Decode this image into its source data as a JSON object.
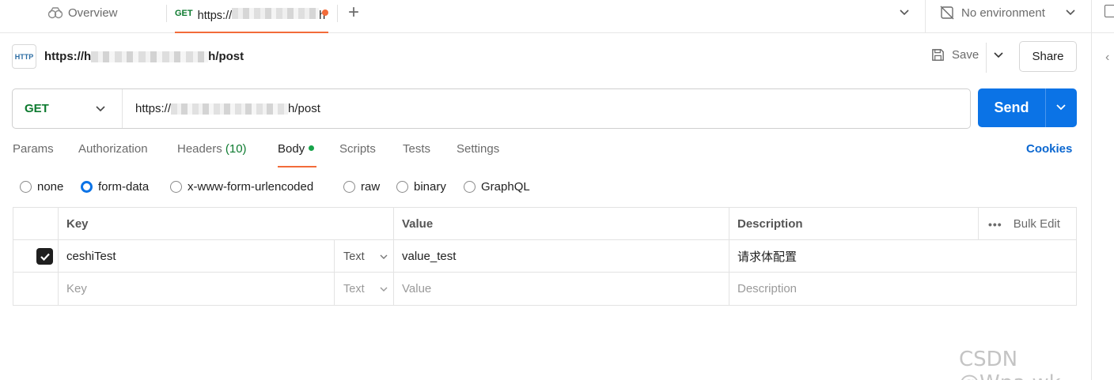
{
  "tabbar": {
    "overview_label": "Overview",
    "active_tab": {
      "method": "GET",
      "url_prefix": "https://",
      "url_suffix": "h",
      "unsaved": true
    },
    "environment_label": "No environment"
  },
  "request": {
    "title_prefix": "https://h",
    "title_suffix": "h/post",
    "save_label": "Save",
    "share_label": "Share",
    "method": "GET",
    "url_prefix": "https://",
    "url_suffix": "h/post",
    "send_label": "Send"
  },
  "tabs": {
    "params": "Params",
    "authorization": "Authorization",
    "headers": "Headers",
    "headers_count": "(10)",
    "body": "Body",
    "scripts": "Scripts",
    "tests": "Tests",
    "settings": "Settings",
    "cookies": "Cookies"
  },
  "body_types": {
    "none": "none",
    "form_data": "form-data",
    "urlencoded": "x-www-form-urlencoded",
    "raw": "raw",
    "binary": "binary",
    "graphql": "GraphQL",
    "selected": "form-data"
  },
  "table": {
    "headers": {
      "key": "Key",
      "value": "Value",
      "description": "Description",
      "bulk_edit": "Bulk Edit"
    },
    "rows": [
      {
        "checked": true,
        "key": "ceshiTest",
        "type": "Text",
        "value": "value_test",
        "description": "请求体配置"
      }
    ],
    "empty_row": {
      "key_placeholder": "Key",
      "type": "Text",
      "value_placeholder": "Value",
      "description_placeholder": "Description"
    }
  },
  "watermark": "CSDN @Wpa.wk",
  "colors": {
    "accent": "#0b73e6",
    "get_method": "#0d7a2f",
    "tab_indicator": "#f26b3a",
    "body_dot": "#17a34a"
  }
}
